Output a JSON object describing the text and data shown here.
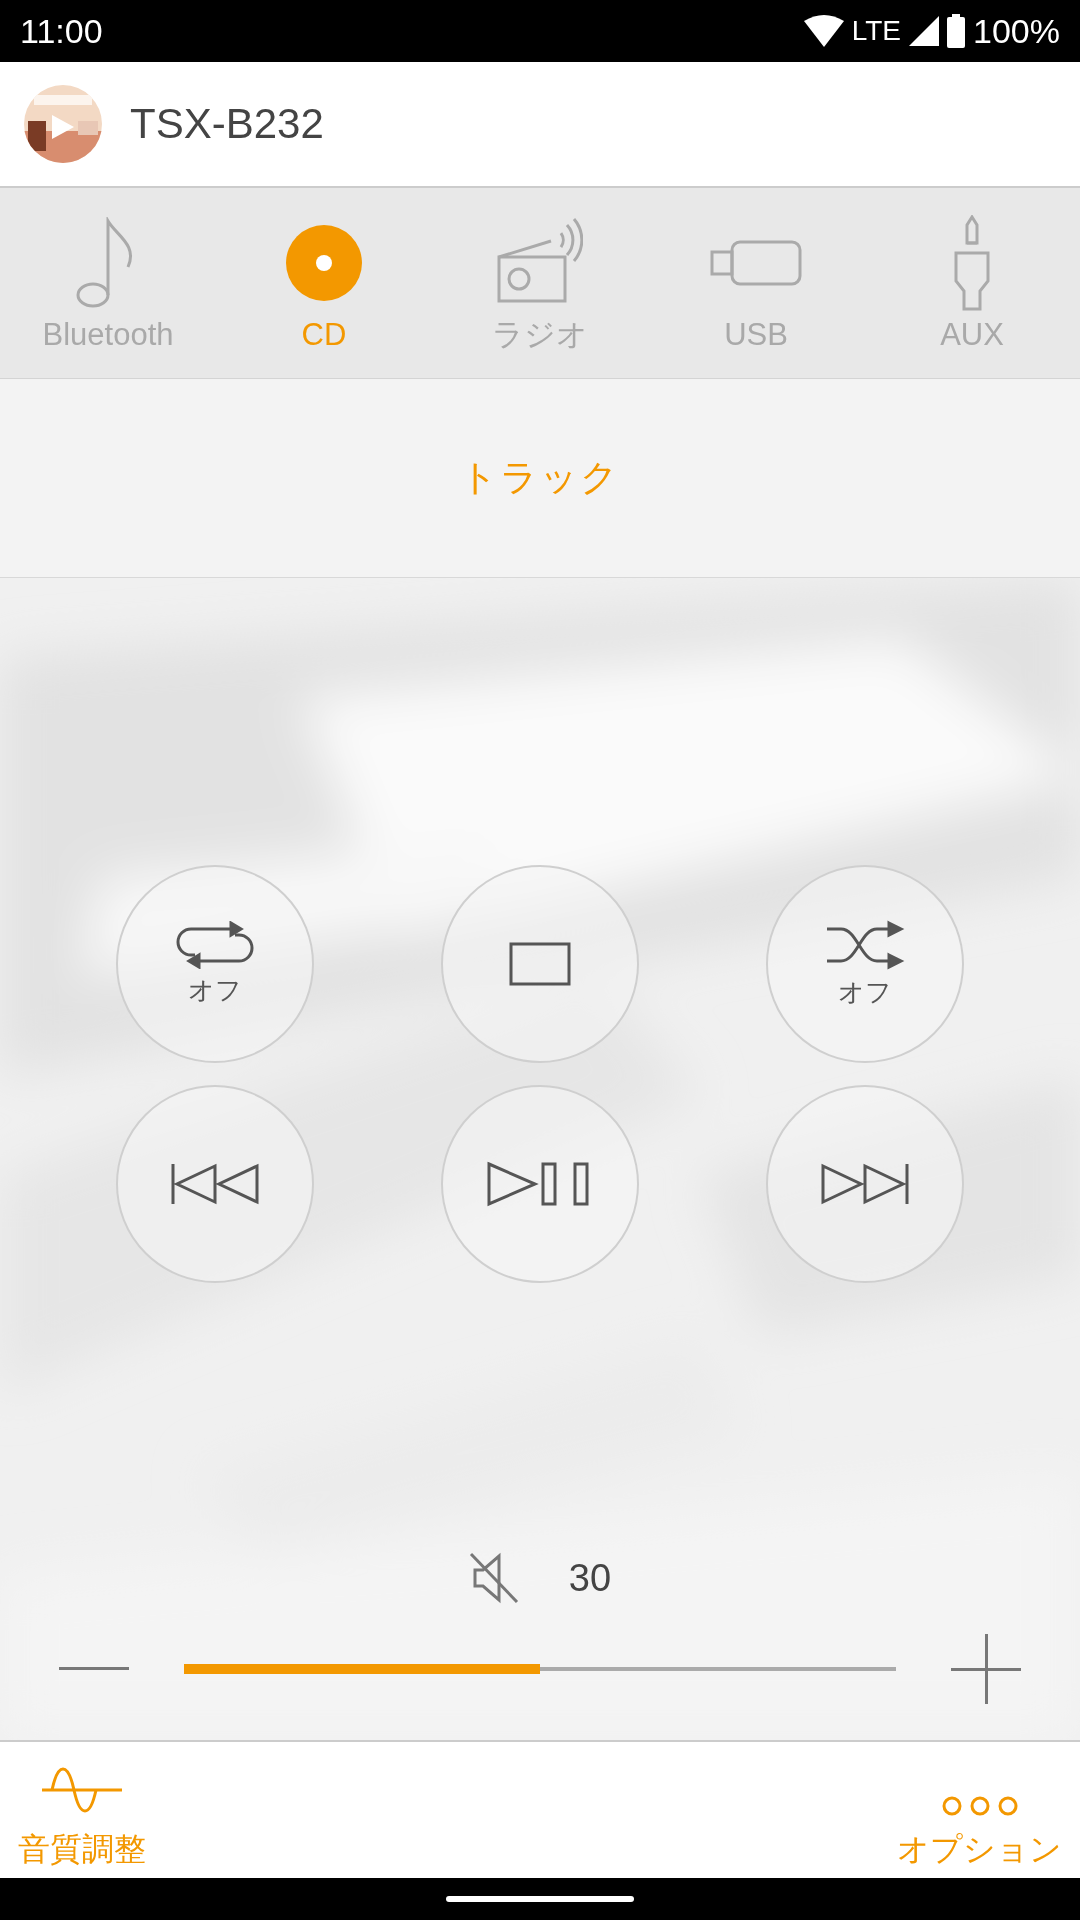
{
  "status_bar": {
    "time": "11:00",
    "network": "LTE",
    "battery": "100%"
  },
  "header": {
    "title": "TSX-B232"
  },
  "sources": [
    {
      "kind": "bluetooth",
      "label": "Bluetooth",
      "selected": false
    },
    {
      "kind": "cd",
      "label": "CD",
      "selected": true
    },
    {
      "kind": "radio",
      "label": "ラジオ",
      "selected": false
    },
    {
      "kind": "usb",
      "label": "USB",
      "selected": false
    },
    {
      "kind": "aux",
      "label": "AUX",
      "selected": false
    }
  ],
  "track": {
    "label": "トラック"
  },
  "controls": [
    {
      "kind": "repeat",
      "label": "オフ"
    },
    {
      "kind": "stop"
    },
    {
      "kind": "shuffle",
      "label": "オフ"
    },
    {
      "kind": "previous"
    },
    {
      "kind": "play_pause"
    },
    {
      "kind": "next"
    }
  ],
  "volume": {
    "muted": true,
    "reading": "30",
    "level": 0.5
  },
  "bottom_bar": [
    {
      "kind": "equalizer",
      "label": "音質調整"
    },
    {
      "kind": "options",
      "label": "オプション"
    }
  ]
}
